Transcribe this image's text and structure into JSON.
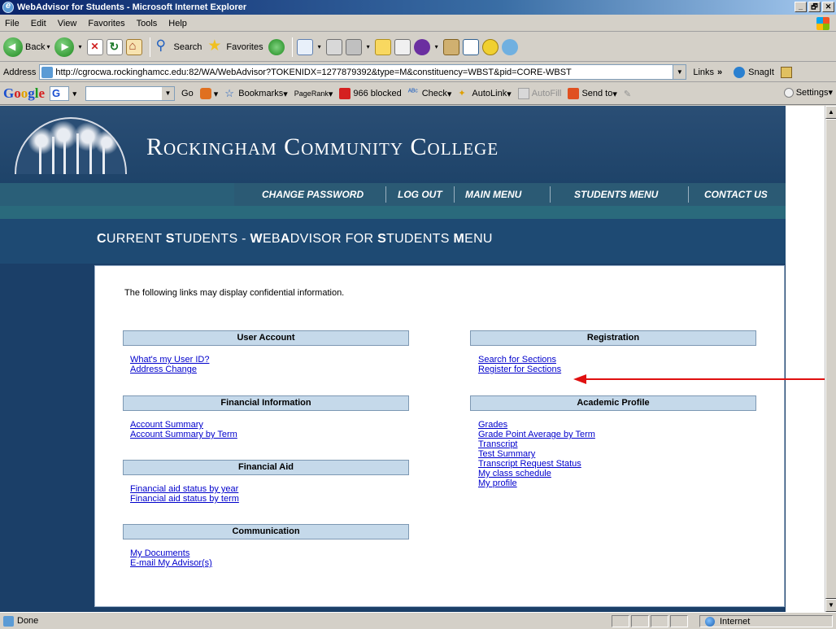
{
  "window": {
    "title": "WebAdvisor for Students - Microsoft Internet Explorer",
    "controls": [
      "_",
      "🗗",
      "✕"
    ]
  },
  "menu": [
    "File",
    "Edit",
    "View",
    "Favorites",
    "Tools",
    "Help"
  ],
  "toolbar": {
    "back_label": "Back",
    "search_label": "Search",
    "favorites_label": "Favorites"
  },
  "address": {
    "label": "Address",
    "url": "http://cgrocwa.rockinghamcc.edu:82/WA/WebAdvisor?TOKENIDX=1277879392&type=M&constituency=WBST&pid=CORE-WBST",
    "links_label": "Links",
    "snagit_label": "SnagIt"
  },
  "google": {
    "go_label": "Go",
    "bookmarks_label": "Bookmarks",
    "pagerank_label": "PageRank",
    "blocked_label": "966 blocked",
    "check_label": "Check",
    "autolink_label": "AutoLink",
    "autofill_label": "AutoFill",
    "sendto_label": "Send to",
    "settings_label": "Settings"
  },
  "site": {
    "college_name": "Rockingham Community College",
    "nav": [
      "CHANGE PASSWORD",
      "LOG OUT",
      "MAIN MENU",
      "STUDENTS MENU",
      "CONTACT US"
    ],
    "page_title_parts": [
      {
        "t": "C",
        "b": true
      },
      {
        "t": "URRENT ",
        "b": false
      },
      {
        "t": "S",
        "b": true
      },
      {
        "t": "TUDENTS - ",
        "b": false
      },
      {
        "t": "W",
        "b": true
      },
      {
        "t": "EB",
        "b": false
      },
      {
        "t": "A",
        "b": true
      },
      {
        "t": "DVISOR FOR ",
        "b": false
      },
      {
        "t": "S",
        "b": true
      },
      {
        "t": "TUDENTS ",
        "b": false
      },
      {
        "t": "M",
        "b": true
      },
      {
        "t": "ENU",
        "b": false
      }
    ]
  },
  "content": {
    "intro": "The following links may display confidential information.",
    "sections": {
      "user_account": {
        "title": "User Account",
        "links": [
          "What's my User ID?",
          "Address Change"
        ]
      },
      "financial_information": {
        "title": "Financial Information",
        "links": [
          "Account Summary",
          "Account Summary by Term"
        ]
      },
      "financial_aid": {
        "title": "Financial Aid",
        "links": [
          "Financial aid status by year",
          "Financial aid status by term"
        ]
      },
      "communication": {
        "title": "Communication",
        "links": [
          "My Documents",
          "E-mail My Advisor(s)"
        ]
      },
      "registration": {
        "title": "Registration",
        "links": [
          "Search for Sections",
          "Register for Sections"
        ]
      },
      "academic_profile": {
        "title": "Academic Profile",
        "links": [
          "Grades",
          "Grade Point Average by Term",
          "Transcript",
          "Test Summary",
          "Transcript Request Status",
          "My class schedule",
          "My profile"
        ]
      }
    }
  },
  "status": {
    "text": "Done",
    "zone": "Internet"
  },
  "colors": {
    "arrow": "#e01010",
    "link": "#0000cc",
    "section_bg": "#c5d9ea",
    "page_bg": "#1b3f68"
  }
}
